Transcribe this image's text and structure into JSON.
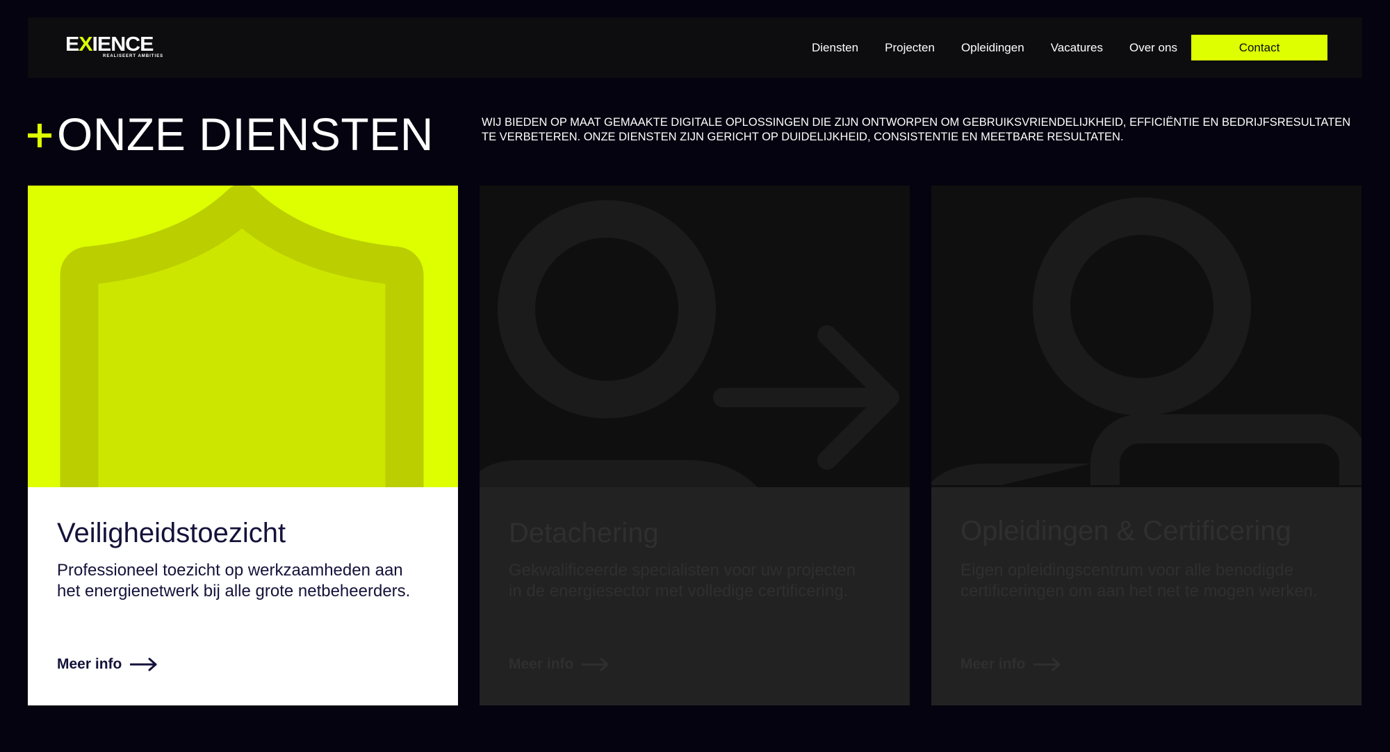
{
  "brand": {
    "logo_text_pre": "E",
    "logo_text_x": "X",
    "logo_text_post": "IENCE",
    "logo_tagline": "REALISEERT AMBITIES",
    "accent_color": "#ddff00",
    "background_color": "#04030f"
  },
  "nav": {
    "links": [
      "Diensten",
      "Projecten",
      "Opleidingen",
      "Vacatures",
      "Over ons"
    ],
    "contact_label": "Contact"
  },
  "section": {
    "title": "ONZE DIENSTEN",
    "intro": "Wij bieden op maat gemaakte digitale oplossingen die zijn ontworpen om gebruiksvriendelijkheid, efficiëntie en bedrijfsresultaten te verbeteren. Onze diensten zijn gericht op duidelijkheid, consistentie en meetbare resultaten."
  },
  "cards": [
    {
      "title": "Veiligheidstoezicht",
      "description": "Professioneel toezicht op werkzaamheden aan het energienetwerk bij alle grote netbeheerders.",
      "link": "Meer info",
      "icon": "shield-icon",
      "active": true
    },
    {
      "title": "Detachering",
      "description": "Gekwalificeerde specialisten voor uw projecten in de energiesector met volledige certificering.",
      "link": "Meer info",
      "icon": "user-arrow-icon",
      "active": false
    },
    {
      "title": "Opleidingen & Certificering",
      "description": "Eigen opleidingscentrum voor alle benodigde certificeringen om aan het net te mogen werken.",
      "link": "Meer info",
      "icon": "user-badge-icon",
      "active": false
    }
  ]
}
